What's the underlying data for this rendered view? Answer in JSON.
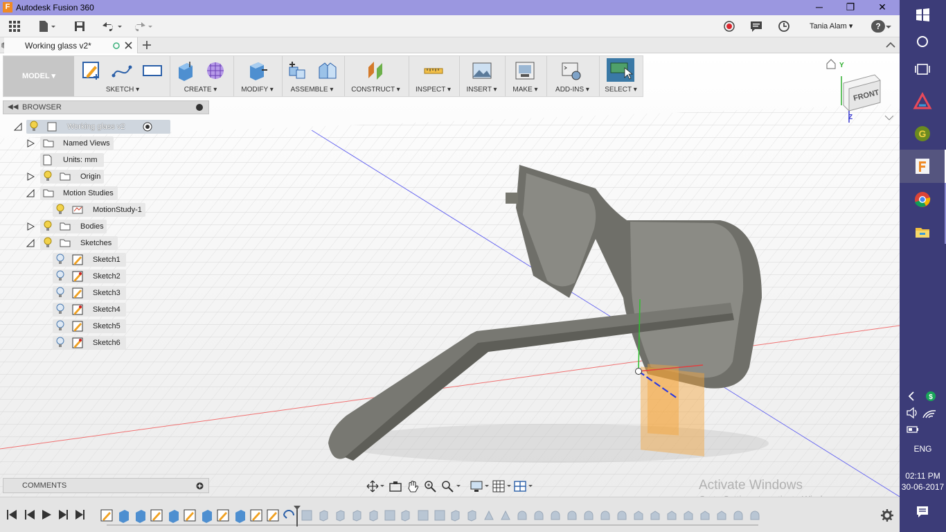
{
  "window": {
    "title": "Autodesk Fusion 360",
    "logo_letter": "F",
    "minimize": "─",
    "maximize": "❐",
    "close": "✕"
  },
  "quickbar": {
    "user": "Tania Alam",
    "user_caret": "▾",
    "help": "?"
  },
  "document_tab": {
    "name": "Working glass v2*"
  },
  "workspace": {
    "label": "MODEL ▾"
  },
  "toolbar": {
    "sketch": "SKETCH ▾",
    "create": "CREATE ▾",
    "modify": "MODIFY ▾",
    "assemble": "ASSEMBLE ▾",
    "construct": "CONSTRUCT ▾",
    "inspect": "INSPECT ▾",
    "insert": "INSERT ▾",
    "make": "MAKE ▾",
    "addins": "ADD-INS ▾",
    "select": "SELECT ▾"
  },
  "browser": {
    "title": "BROWSER",
    "root": "Working glass v2",
    "named_views": "Named Views",
    "units": "Units: mm",
    "origin": "Origin",
    "motion_studies": "Motion Studies",
    "motion_study_1": "MotionStudy-1",
    "bodies": "Bodies",
    "sketches": "Sketches",
    "sketch_items": [
      "Sketch1",
      "Sketch2",
      "Sketch3",
      "Sketch4",
      "Sketch5",
      "Sketch6"
    ]
  },
  "viewcube": {
    "face": "FRONT",
    "axis_y": "Y",
    "axis_z": "Z"
  },
  "comments": {
    "title": "COMMENTS"
  },
  "watermark": {
    "line1": "Activate Windows",
    "line2": "Go to Settings to activate Windows."
  },
  "taskbar": {
    "language": "ENG",
    "time": "02:11 PM",
    "date": "30-06-2017"
  },
  "colors": {
    "title_bar": "#9b97e0",
    "taskbar": "#3c3c78",
    "select_active": "#3a79a6",
    "model_body": "#7a7a74"
  }
}
